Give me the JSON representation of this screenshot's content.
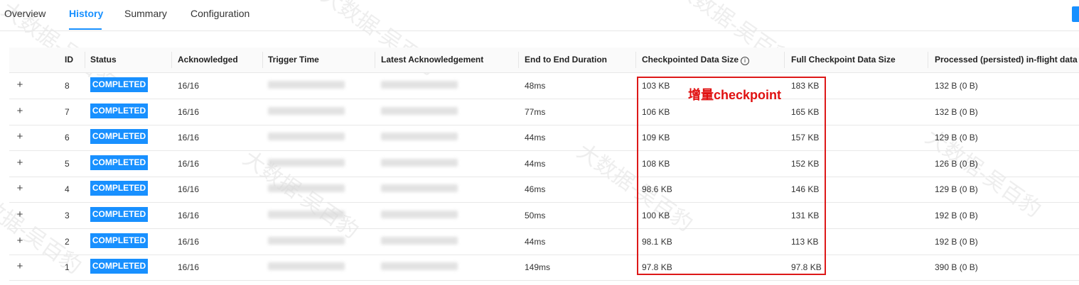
{
  "tabs": [
    {
      "label": "Overview",
      "active": false
    },
    {
      "label": "History",
      "active": true
    },
    {
      "label": "Summary",
      "active": false
    },
    {
      "label": "Configuration",
      "active": false
    }
  ],
  "table": {
    "columns": {
      "id": "ID",
      "status": "Status",
      "acknowledged": "Acknowledged",
      "trigger_time": "Trigger Time",
      "latest_ack": "Latest Acknowledgement",
      "duration": "End to End Duration",
      "checkpointed_size": "Checkpointed Data Size",
      "full_size": "Full Checkpoint Data Size",
      "processed": "Processed (persisted) in-flight data"
    },
    "info_icon": "info-circle-icon",
    "expand_symbol": "+",
    "rows": [
      {
        "id": "8",
        "status": "COMPLETED",
        "acknowledged": "16/16",
        "duration": "48ms",
        "checkpointed_size": "103 KB",
        "full_size": "183 KB",
        "processed": "132 B (0 B)"
      },
      {
        "id": "7",
        "status": "COMPLETED",
        "acknowledged": "16/16",
        "duration": "77ms",
        "checkpointed_size": "106 KB",
        "full_size": "165 KB",
        "processed": "132 B (0 B)"
      },
      {
        "id": "6",
        "status": "COMPLETED",
        "acknowledged": "16/16",
        "duration": "44ms",
        "checkpointed_size": "109 KB",
        "full_size": "157 KB",
        "processed": "129 B (0 B)"
      },
      {
        "id": "5",
        "status": "COMPLETED",
        "acknowledged": "16/16",
        "duration": "44ms",
        "checkpointed_size": "108 KB",
        "full_size": "152 KB",
        "processed": "126 B (0 B)"
      },
      {
        "id": "4",
        "status": "COMPLETED",
        "acknowledged": "16/16",
        "duration": "46ms",
        "checkpointed_size": "98.6 KB",
        "full_size": "146 KB",
        "processed": "129 B (0 B)"
      },
      {
        "id": "3",
        "status": "COMPLETED",
        "acknowledged": "16/16",
        "duration": "50ms",
        "checkpointed_size": "100 KB",
        "full_size": "131 KB",
        "processed": "192 B (0 B)"
      },
      {
        "id": "2",
        "status": "COMPLETED",
        "acknowledged": "16/16",
        "duration": "44ms",
        "checkpointed_size": "98.1 KB",
        "full_size": "113 KB",
        "processed": "192 B (0 B)"
      },
      {
        "id": "1",
        "status": "COMPLETED",
        "acknowledged": "16/16",
        "duration": "149ms",
        "checkpointed_size": "97.8 KB",
        "full_size": "97.8 KB",
        "processed": "390 B (0 B)"
      }
    ]
  },
  "annotation": {
    "label": "增量checkpoint",
    "color": "#e01010"
  },
  "watermark": "大数据-吴百豹",
  "colors": {
    "accent": "#1890ff",
    "badge_bg": "#1890ff",
    "annotation_border": "#dd1818"
  }
}
